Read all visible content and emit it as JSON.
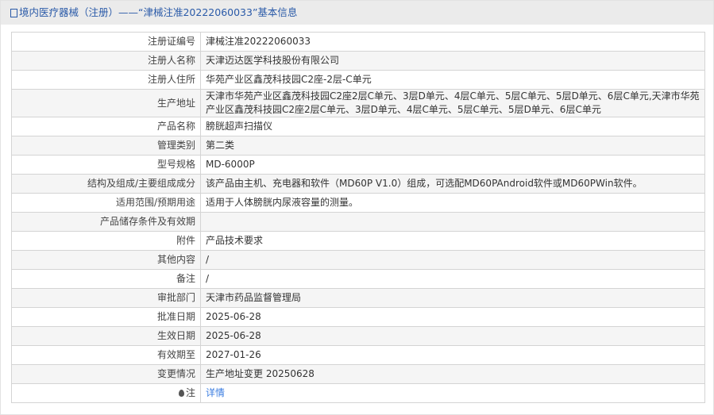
{
  "header": {
    "title": "境内医疗器械（注册）——“津械注准20222060033”基本信息"
  },
  "rows": [
    {
      "label": "注册证编号",
      "value": "津械注准20222060033"
    },
    {
      "label": "注册人名称",
      "value": "天津迈达医学科技股份有限公司"
    },
    {
      "label": "注册人住所",
      "value": "华苑产业区鑫茂科技园C2座-2层-C单元"
    },
    {
      "label": "生产地址",
      "value": "天津市华苑产业区鑫茂科技园C2座2层C单元、3层D单元、4层C单元、5层C单元、5层D单元、6层C单元,天津市华苑产业区鑫茂科技园C2座2层C单元、3层D单元、4层C单元、5层C单元、5层D单元、6层C单元"
    },
    {
      "label": "产品名称",
      "value": "膀胱超声扫描仪"
    },
    {
      "label": "管理类别",
      "value": "第二类"
    },
    {
      "label": "型号规格",
      "value": "MD-6000P"
    },
    {
      "label": "结构及组成/主要组成成分",
      "value": "该产品由主机、充电器和软件（MD60P V1.0）组成，可选配MD60PAndroid软件或MD60PWin软件。"
    },
    {
      "label": "适用范围/预期用途",
      "value": "适用于人体膀胱内尿液容量的测量。"
    },
    {
      "label": "产品储存条件及有效期",
      "value": ""
    },
    {
      "label": "附件",
      "value": "产品技术要求"
    },
    {
      "label": "其他内容",
      "value": "/"
    },
    {
      "label": "备注",
      "value": "/"
    },
    {
      "label": "审批部门",
      "value": "天津市药品监督管理局"
    },
    {
      "label": "批准日期",
      "value": "2025-06-28"
    },
    {
      "label": "生效日期",
      "value": "2025-06-28"
    },
    {
      "label": "有效期至",
      "value": "2027-01-26"
    },
    {
      "label": "变更情况",
      "value": "生产地址变更 20250628"
    }
  ],
  "note": {
    "label": "注",
    "link": "详情"
  }
}
